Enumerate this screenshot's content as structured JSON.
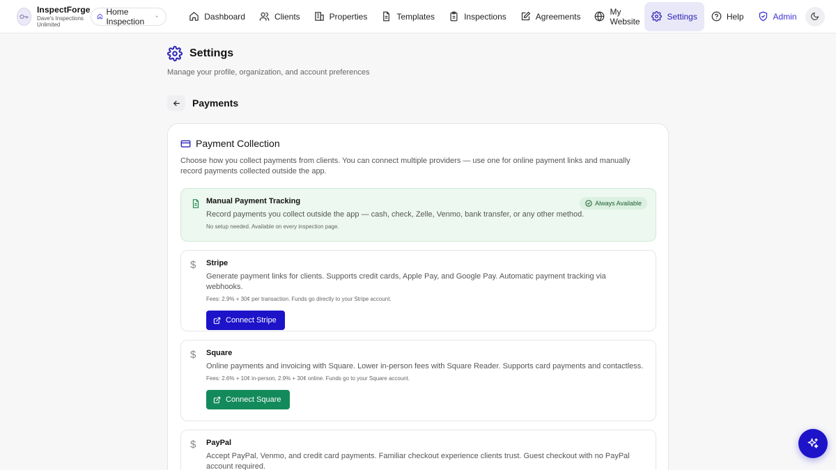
{
  "brand": {
    "name": "InspectForge",
    "subtitle": "Dave's Inspections Unlimited"
  },
  "inspection_type": {
    "label": "Home Inspection",
    "icon": "home-icon"
  },
  "nav": [
    {
      "label": "Dashboard",
      "icon": "home-icon"
    },
    {
      "label": "Clients",
      "icon": "users-icon"
    },
    {
      "label": "Properties",
      "icon": "building-icon"
    },
    {
      "label": "Templates",
      "icon": "document-icon"
    },
    {
      "label": "Inspections",
      "icon": "clipboard-icon"
    },
    {
      "label": "Agreements",
      "icon": "pen-square-icon"
    },
    {
      "label": "My Website",
      "icon": "globe-icon"
    },
    {
      "label": "Settings",
      "icon": "gear-icon",
      "active": true
    },
    {
      "label": "Help",
      "icon": "help-circle-icon"
    },
    {
      "label": "Admin",
      "icon": "shield-check-icon"
    }
  ],
  "page": {
    "title": "Settings",
    "subtitle": "Manage your profile, organization, and account preferences",
    "section": "Payments"
  },
  "payment_collection": {
    "title": "Payment Collection",
    "description": "Choose how you collect payments from clients. You can connect multiple providers — use one for online payment links and manually record payments collected outside the app.",
    "manual": {
      "name": "Manual Payment Tracking",
      "description": "Record payments you collect outside the app — cash, check, Zelle, Venmo, bank transfer, or any other method.",
      "note": "No setup needed. Available on every inspection page.",
      "badge": "Always Available"
    },
    "stripe": {
      "name": "Stripe",
      "description": "Generate payment links for clients. Supports credit cards, Apple Pay, and Google Pay. Automatic payment tracking via webhooks.",
      "fees": "Fees: 2.9% + 30¢ per transaction. Funds go directly to your Stripe account.",
      "button": "Connect Stripe"
    },
    "square": {
      "name": "Square",
      "description": "Online payments and invoicing with Square. Lower in-person fees with Square Reader. Supports card payments and contactless.",
      "fees": "Fees: 2.6% + 10¢ in-person, 2.9% + 30¢ online. Funds go to your Square account.",
      "button": "Connect Square"
    },
    "paypal": {
      "name": "PayPal",
      "description": "Accept PayPal, Venmo, and credit card payments. Familiar checkout experience clients trust. Guest checkout with no PayPal account required."
    }
  },
  "colors": {
    "accent": "#1d13c9",
    "active_nav_bg": "#e9e8f8",
    "square_green": "#138a5a",
    "manual_bg": "#edf8f0"
  }
}
